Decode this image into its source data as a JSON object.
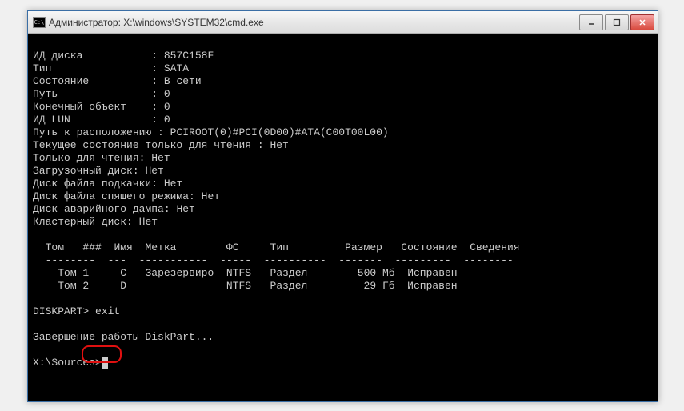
{
  "window": {
    "title": "Администратор: X:\\windows\\SYSTEM32\\cmd.exe",
    "icon_label": "C:\\"
  },
  "disk_info": {
    "id_label": "ИД диска",
    "id_value": "857C158F",
    "type_label": "Тип",
    "type_value": "SATA",
    "state_label": "Состояние",
    "state_value": "В сети",
    "path_label": "Путь",
    "path_value": "0",
    "target_label": "Конечный объект",
    "target_value": "0",
    "lun_label": "ИД LUN",
    "lun_value": "0",
    "location_label": "Путь к расположению",
    "location_value": "PCIROOT(0)#PCI(0D00)#ATA(C00T00L00)",
    "readonly_current_label": "Текущее состояние только для чтения",
    "readonly_current_value": "Нет",
    "readonly_label": "Только для чтения",
    "readonly_value": "Нет",
    "boot_label": "Загрузочный диск",
    "boot_value": "Нет",
    "pagefile_label": "Диск файла подкачки",
    "pagefile_value": "Нет",
    "hibernate_label": "Диск файла спящего режима",
    "hibernate_value": "Нет",
    "crashdump_label": "Диск аварийного дампа",
    "crashdump_value": "Нет",
    "cluster_label": "Кластерный диск",
    "cluster_value": "Нет"
  },
  "table": {
    "headers": {
      "volume": "Том",
      "num": "###",
      "name": "Имя",
      "label": "Метка",
      "fs": "ФС",
      "type": "Тип",
      "size": "Размер",
      "state": "Состояние",
      "info": "Сведения"
    },
    "rows": [
      {
        "volume": "Том 1",
        "name": "C",
        "label": "Зарезервиро",
        "fs": "NTFS",
        "type": "Раздел",
        "size": "500 Мб",
        "state": "Исправен"
      },
      {
        "volume": "Том 2",
        "name": "D",
        "label": "",
        "fs": "NTFS",
        "type": "Раздел",
        "size": "29 Гб",
        "state": "Исправен"
      }
    ]
  },
  "prompt": {
    "diskpart": "DISKPART>",
    "command": "exit",
    "exit_msg": "Завершение работы DiskPart...",
    "next_prompt": "X:\\Sources>"
  }
}
